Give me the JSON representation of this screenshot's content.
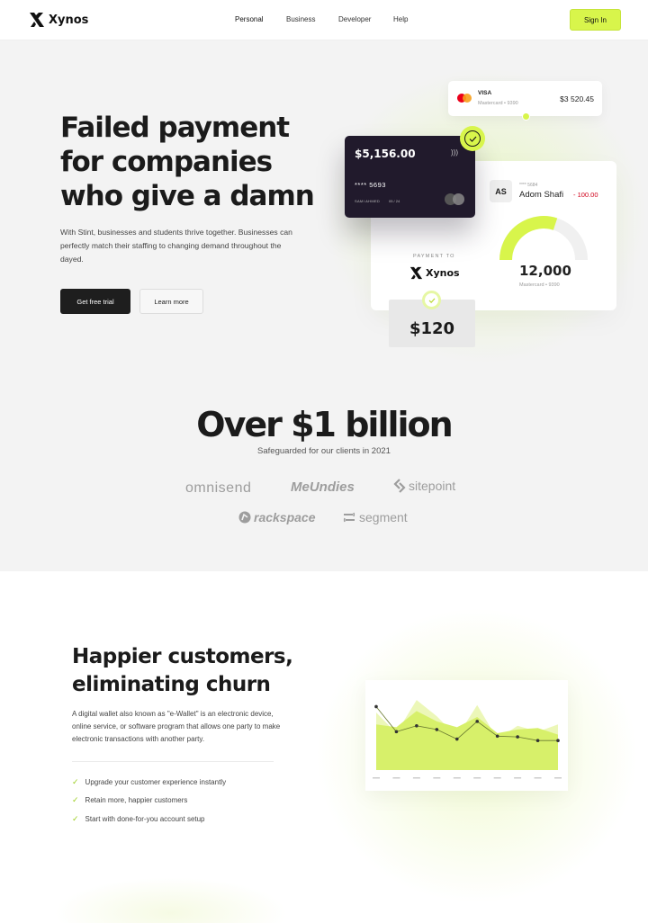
{
  "brand": {
    "name": "Xynos"
  },
  "nav": {
    "links": [
      "Personal",
      "Business",
      "Developer",
      "Help"
    ],
    "signin": "Sign In"
  },
  "hero": {
    "title": "Failed payment for companies who give a damn",
    "description": "With Stint, businesses and students thrive together. Businesses can perfectly match their staffing to changing demand throughout the dayed.",
    "cta_primary": "Get free trial",
    "cta_secondary": "Learn more"
  },
  "visa_notice": {
    "label": "VISA",
    "sub": "Mastercard • 9390",
    "amount": "$3 520.45"
  },
  "dark_card": {
    "balance": "$5,156.00",
    "number": "**** 5693",
    "holder": "SAMI AHMED",
    "expiry": "05 / 24"
  },
  "payment_panel": {
    "pay_to": "PAYMENT TO",
    "payee": "Xynos",
    "avatar": "AS",
    "card_number": "**** 5684",
    "name": "Adom Shafi",
    "delta": "- 100.00",
    "total": "12,000",
    "total_sub": "Mastercard • 9390",
    "gauge_level": 0.6
  },
  "amount": "$120",
  "stats": {
    "headline": "Over $1 billion",
    "sub": "Safeguarded for our clients in 2021"
  },
  "clients": [
    "omnisend",
    "MeUndies",
    "sitepoint",
    "rackspace",
    "segment"
  ],
  "section2": {
    "title": "Happier customers, eliminating churn",
    "description": "A digital wallet also known as \"e-Wallet\" is an electronic device, online service, or software program that allows one party to make electronic transactions with another party.",
    "features": [
      "Upgrade your customer experience instantly",
      "Retain more, happier customers",
      "Start with done-for-you account setup"
    ]
  },
  "colors": {
    "accent": "#d8f54b",
    "dark": "#211a2c",
    "negative": "#d0021b",
    "chart_fill": "#d7f06a",
    "chart_fill_light": "#ecf7b8"
  },
  "chart_data": {
    "type": "area",
    "title": "",
    "xlabel": "",
    "ylabel": "",
    "x_tick_labels_legible": false,
    "point_count": 10,
    "ylim": [
      0,
      100
    ],
    "series": [
      {
        "values": [
          78,
          50,
          95,
          73,
          45,
          88,
          42,
          60,
          52,
          62
        ]
      },
      {
        "values": [
          62,
          58,
          80,
          66,
          58,
          72,
          50,
          55,
          57,
          48
        ]
      }
    ],
    "line": [
      86,
      52,
      60,
      55,
      42,
      66,
      46,
      45,
      40,
      40
    ]
  }
}
